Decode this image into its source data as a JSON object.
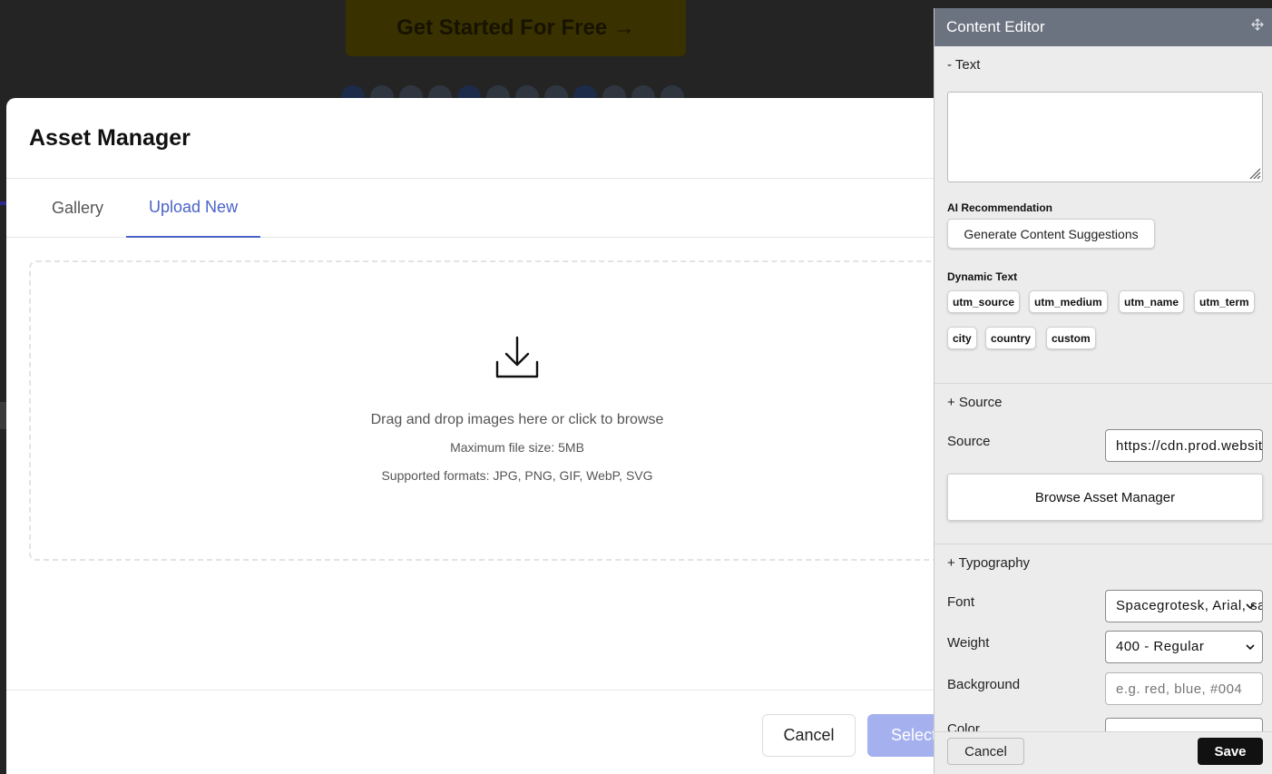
{
  "background": {
    "cta_label": "Get Started For Free →"
  },
  "asset_manager": {
    "title": "Asset Manager",
    "tabs": [
      {
        "label": "Gallery",
        "active": false
      },
      {
        "label": "Upload New",
        "active": true
      }
    ],
    "dropzone": {
      "icon": "download-icon",
      "instruction": "Drag and drop images here or click to browse",
      "max_size": "Maximum file size: 5MB",
      "formats": "Supported formats: JPG, PNG, GIF, WebP, SVG"
    },
    "footer": {
      "cancel_label": "Cancel",
      "select_label": "Select"
    },
    "accent_color": "#4a63c8"
  },
  "content_editor": {
    "title": "Content Editor",
    "move_icon": "move-icon",
    "text_section": {
      "toggle_label": "- Text",
      "textarea_value": "",
      "ai_label": "AI Recommendation",
      "generate_label": "Generate Content Suggestions",
      "dynamic_label": "Dynamic Text",
      "chips": [
        "utm_source",
        "utm_medium",
        "utm_name",
        "utm_term",
        "city",
        "country",
        "custom"
      ]
    },
    "source_section": {
      "toggle_label": "+ Source",
      "source_label": "Source",
      "source_value": "https://cdn.prod.website-files.com",
      "browse_label": "Browse Asset Manager"
    },
    "typography_section": {
      "toggle_label": "+ Typography",
      "font_label": "Font",
      "font_value": "Spacegrotesk, Arial, sans-serif",
      "weight_label": "Weight",
      "weight_value": "400 - Regular",
      "background_label": "Background",
      "background_placeholder": "e.g. red, blue, #004",
      "color_label": "Color"
    },
    "footer": {
      "cancel_label": "Cancel",
      "save_label": "Save"
    }
  }
}
